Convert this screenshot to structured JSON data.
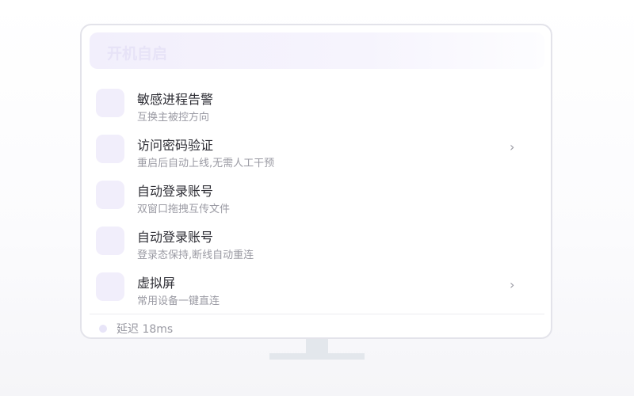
{
  "window": {
    "title": "开机自启"
  },
  "items": [
    {
      "label": "敏感进程告警",
      "desc": "互换主被控方向",
      "has_chevron": false
    },
    {
      "label": "访问密码验证",
      "desc": "重启后自动上线,无需人工干预",
      "has_chevron": true
    },
    {
      "label": "自动登录账号",
      "desc": "双窗口拖拽互传文件",
      "has_chevron": false
    },
    {
      "label": "自动登录账号",
      "desc": "登录态保持,断线自动重连",
      "has_chevron": false
    },
    {
      "label": "虚拟屏",
      "desc": "常用设备一键直连",
      "has_chevron": true
    }
  ],
  "chevron_glyph": "›",
  "status": {
    "text": "延迟 18ms"
  },
  "colors": {
    "accent_light": "#f1eefb",
    "status_dot": "#e8e5f8",
    "stand": "#e3e7ec"
  }
}
